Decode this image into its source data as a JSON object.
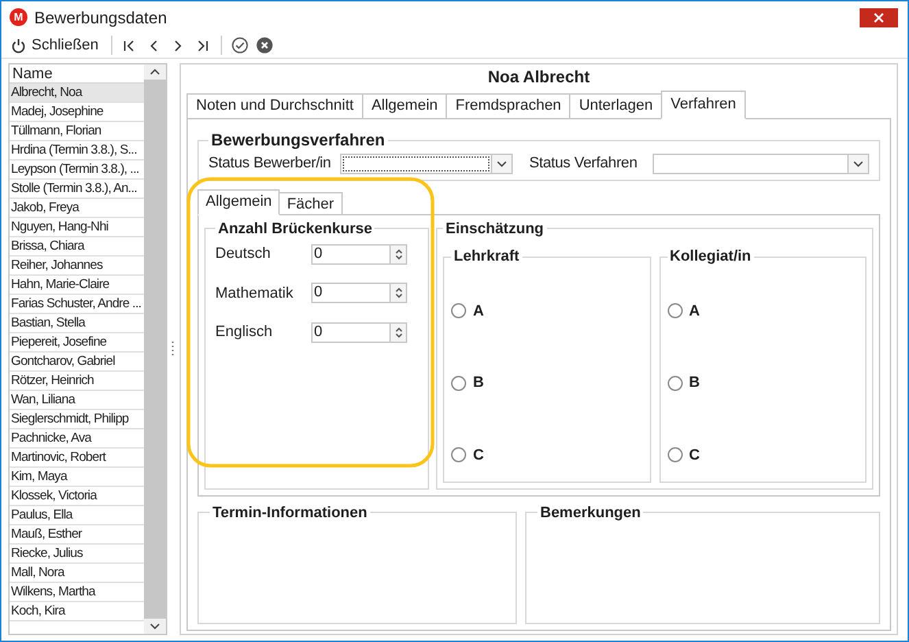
{
  "window": {
    "icon_text": "M",
    "title": "Bewerbungsdaten"
  },
  "toolbar": {
    "close_label": "Schließen"
  },
  "list": {
    "column": "Name",
    "rows": [
      {
        "name": "Albrecht, Noa",
        "selected": true
      },
      {
        "name": "Madej, Josephine",
        "selected": false
      },
      {
        "name": "Tüllmann, Florian",
        "selected": false
      },
      {
        "name": "Hrdina (Termin 3.8.), S...",
        "selected": false
      },
      {
        "name": "Leypson (Termin 3.8.), ...",
        "selected": false
      },
      {
        "name": "Stolle (Termin 3.8.), An...",
        "selected": false
      },
      {
        "name": "Jakob, Freya",
        "selected": false
      },
      {
        "name": "Nguyen, Hang-Nhi",
        "selected": false
      },
      {
        "name": "Brissa, Chiara",
        "selected": false
      },
      {
        "name": "Reiher, Johannes",
        "selected": false
      },
      {
        "name": "Hahn, Marie-Claire",
        "selected": false
      },
      {
        "name": "Farias Schuster, Andre ...",
        "selected": false
      },
      {
        "name": "Bastian, Stella",
        "selected": false
      },
      {
        "name": "Piepereit, Josefine",
        "selected": false
      },
      {
        "name": "Gontcharov, Gabriel",
        "selected": false
      },
      {
        "name": "Rötzer, Heinrich",
        "selected": false
      },
      {
        "name": "Wan, Liliana",
        "selected": false
      },
      {
        "name": "Sieglerschmidt, Philipp",
        "selected": false
      },
      {
        "name": "Pachnicke, Ava",
        "selected": false
      },
      {
        "name": "Martinovic, Robert",
        "selected": false
      },
      {
        "name": "Kim, Maya",
        "selected": false
      },
      {
        "name": "Klossek, Victoria",
        "selected": false
      },
      {
        "name": "Paulus, Ella",
        "selected": false
      },
      {
        "name": "Mauß, Esther",
        "selected": false
      },
      {
        "name": "Riecke, Julius",
        "selected": false
      },
      {
        "name": "Mall, Nora",
        "selected": false
      },
      {
        "name": "Wilkens, Martha",
        "selected": false
      },
      {
        "name": "Koch, Kira",
        "selected": false
      }
    ]
  },
  "detail": {
    "heading": "Noa Albrecht",
    "tabs": [
      {
        "label": "Noten und Durchschnitt",
        "selected": false
      },
      {
        "label": "Allgemein",
        "selected": false
      },
      {
        "label": "Fremdsprachen",
        "selected": false
      },
      {
        "label": "Unterlagen",
        "selected": false
      },
      {
        "label": "Verfahren",
        "selected": true
      }
    ],
    "process": {
      "title": "Bewerbungsverfahren",
      "fields": [
        {
          "label": "Status Bewerber/in",
          "focused": true
        },
        {
          "label": "Status Verfahren",
          "focused": false
        }
      ]
    },
    "subtabs": [
      {
        "label": "Allgemein",
        "selected": true
      },
      {
        "label": "Fächer",
        "selected": false
      }
    ],
    "bridge_courses": {
      "title": "Anzahl Brückenkurse",
      "items": [
        {
          "label": "Deutsch",
          "value": "0"
        },
        {
          "label": "Mathematik",
          "value": "0"
        },
        {
          "label": "Englisch",
          "value": "0"
        }
      ]
    },
    "assessment": {
      "title": "Einschätzung",
      "groups": [
        {
          "title": "Lehrkraft",
          "options": [
            {
              "label": "A",
              "selected": false
            },
            {
              "label": "B",
              "selected": false
            },
            {
              "label": "C",
              "selected": false
            }
          ]
        },
        {
          "title": "Kollegiat/in",
          "options": [
            {
              "label": "A",
              "selected": false
            },
            {
              "label": "B",
              "selected": false
            },
            {
              "label": "C",
              "selected": false
            }
          ]
        }
      ]
    },
    "bottom_groups": [
      {
        "title": "Termin-Informationen"
      },
      {
        "title": "Bemerkungen"
      }
    ]
  }
}
